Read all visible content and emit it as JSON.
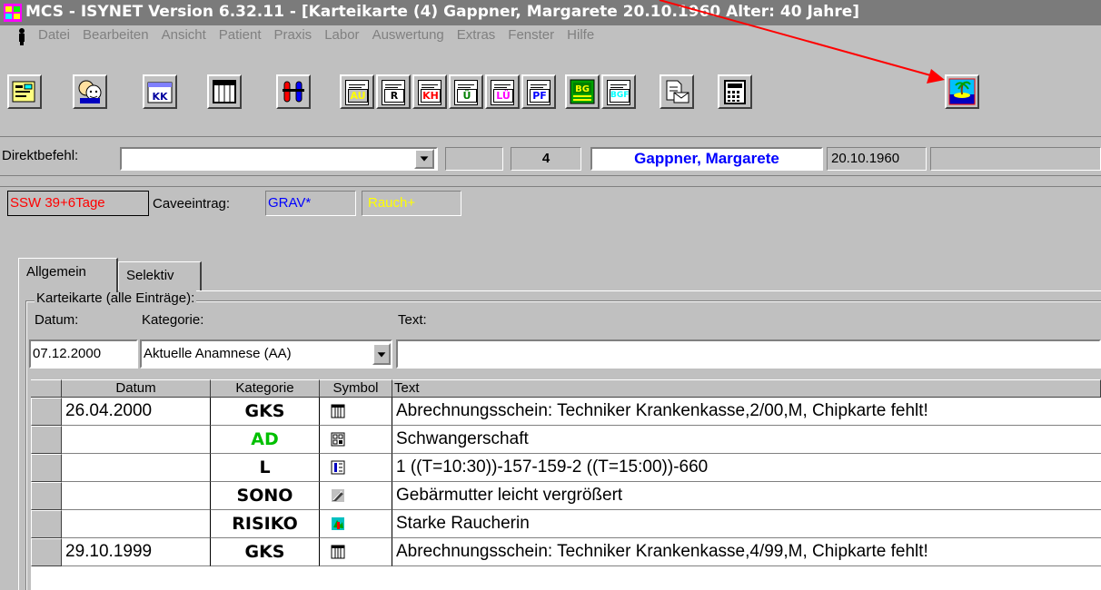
{
  "window": {
    "title": "MCS - ISYNET Version 6.32.11 - [Karteikarte (4) Gappner, Margarete 20.10.1960 Alter: 40 Jahre]"
  },
  "menu": {
    "items": [
      "Datei",
      "Bearbeiten",
      "Ansicht",
      "Patient",
      "Praxis",
      "Labor",
      "Auswertung",
      "Extras",
      "Fenster",
      "Hilfe"
    ]
  },
  "toolbar": {
    "buttons": [
      {
        "name": "patient-card-icon"
      },
      {
        "name": "patients-faces-icon"
      },
      {
        "name": "kk-card-icon",
        "label": "KK"
      },
      {
        "name": "calendar-grid-icon"
      },
      {
        "name": "lab-tubes-icon"
      },
      {
        "name": "form-au-icon",
        "label": "AU",
        "color": "#ffff00"
      },
      {
        "name": "form-r-icon",
        "label": "R",
        "color": "#000000"
      },
      {
        "name": "form-kh-icon",
        "label": "KH",
        "color": "#ff0000"
      },
      {
        "name": "form-u-icon",
        "label": "Ü",
        "color": "#008000"
      },
      {
        "name": "form-lu-icon",
        "label": "LÜ",
        "color": "#ff00ff"
      },
      {
        "name": "form-pf-icon",
        "label": "PF",
        "color": "#0000ff"
      },
      {
        "name": "form-bg-icon",
        "label": "BG",
        "color": "#ffff00"
      },
      {
        "name": "form-bgf-icon",
        "label": "BGF",
        "color": "#00ffff"
      },
      {
        "name": "document-mail-icon"
      },
      {
        "name": "calculator-icon"
      },
      {
        "name": "vacation-island-icon"
      }
    ]
  },
  "command": {
    "label": "Direktbefehl:",
    "value": "",
    "patient_number": "4",
    "patient_name": "Gappner, Margarete",
    "birthdate": "20.10.1960"
  },
  "status": {
    "ssw": "SSW 39+6Tage",
    "cave_label": "Caveeintrag:",
    "cave_value": "GRAV*",
    "smoker": "Rauch+",
    "colors": {
      "ssw": "#ff0000",
      "cave": "#0000ff",
      "smoker": "#ffff00"
    }
  },
  "tabs": [
    {
      "label": "Allgemein",
      "active": true
    },
    {
      "label": "Selektiv",
      "active": false
    }
  ],
  "entry": {
    "group_title": "Karteikarte (alle Einträge):",
    "date_label": "Datum:",
    "category_label": "Kategorie:",
    "text_label": "Text:",
    "date_value": "07.12.2000",
    "category_value": "Aktuelle Anamnese (AA)",
    "text_value": ""
  },
  "grid": {
    "headers": [
      "Datum",
      "Kategorie",
      "Symbol",
      "Text"
    ],
    "rows": [
      {
        "date": "26.04.2000",
        "category": "GKS",
        "color": "#000000",
        "symbol": "calendar-grid-icon",
        "text": "Abrechnungsschein: Techniker Krankenkasse,2/00,M, Chipkarte fehlt!"
      },
      {
        "date": "",
        "category": "AD",
        "color": "#00c000",
        "symbol": "panel-grid-icon",
        "text": "Schwangerschaft"
      },
      {
        "date": "",
        "category": "L",
        "color": "#000000",
        "symbol": "lab-sheet-icon",
        "text": "1 ((T=10:30))-157-159-2 ((T=15:00))-660"
      },
      {
        "date": "",
        "category": "SONO",
        "color": "#000000",
        "symbol": "ultrasound-icon",
        "text": "Gebärmutter leicht vergrößert"
      },
      {
        "date": "",
        "category": "RISIKO",
        "color": "#000000",
        "symbol": "risk-map-icon",
        "text": "Starke Raucherin"
      },
      {
        "date": "29.10.1999",
        "category": "GKS",
        "color": "#000000",
        "symbol": "calendar-grid-icon",
        "text": "Abrechnungsschein: Techniker Krankenkasse,4/99,M, Chipkarte fehlt!"
      }
    ]
  }
}
